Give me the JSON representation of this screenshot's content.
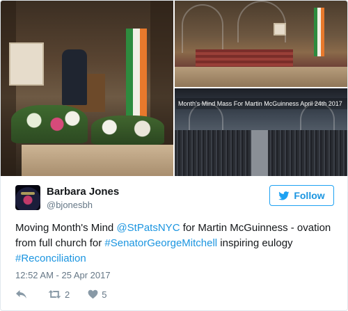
{
  "media": {
    "caption": "Month's Mind Mass For Martin McGuinness April 24th 2017"
  },
  "author": {
    "display_name": "Barbara Jones",
    "handle": "@bjonesbh"
  },
  "follow": {
    "label": "Follow",
    "icon": "twitter-bird-icon"
  },
  "tweet": {
    "segments": [
      {
        "text": "Moving Month's Mind ",
        "link": false
      },
      {
        "text": "@StPatsNYC",
        "link": true
      },
      {
        "text": " for Martin McGuinness - ovation from full church for ",
        "link": false
      },
      {
        "text": "#SenatorGeorgeMitchell",
        "link": true
      },
      {
        "text": " inspiring eulogy ",
        "link": false
      },
      {
        "text": "#Reconciliation",
        "link": true
      }
    ],
    "timestamp": "12:52 AM - 25 Apr 2017"
  },
  "actions": {
    "reply_icon": "reply-icon",
    "retweet_icon": "retweet-icon",
    "retweet_count": "2",
    "like_icon": "heart-icon",
    "like_count": "5"
  },
  "colors": {
    "link": "#1b95e0",
    "text": "#14171a",
    "muted": "#657786",
    "border": "#e1e8ed"
  }
}
